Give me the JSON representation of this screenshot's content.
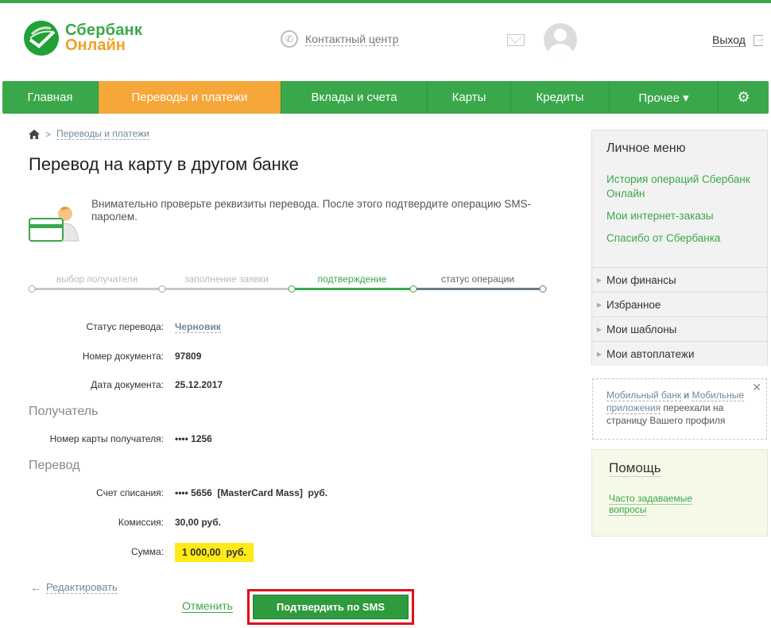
{
  "header": {
    "logo_line1": "Сбербанк",
    "logo_line2": "Онлайн",
    "contact_center": "Контактный центр",
    "logout": "Выход"
  },
  "nav": {
    "items": [
      "Главная",
      "Переводы и платежи",
      "Вклады и счета",
      "Карты",
      "Кредиты",
      "Прочее ▾"
    ],
    "active_index": 1,
    "settings_icon": "gear-icon"
  },
  "breadcrumb": {
    "link": "Переводы и платежи"
  },
  "page_title": "Перевод на карту в другом банке",
  "notice": "Внимательно проверьте реквизиты перевода. После этого подтвердите операцию SMS-паролем.",
  "steps": {
    "labels": [
      "выбор получателя",
      "заполнение заявки",
      "подтверждение",
      "статус операции"
    ],
    "current_index": 2
  },
  "details": {
    "status_label": "Статус перевода:",
    "status_value": "Черновик",
    "doc_number_label": "Номер документа:",
    "doc_number_value": "97809",
    "doc_date_label": "Дата документа:",
    "doc_date_value": "25.12.2017",
    "recipient_section": "Получатель",
    "card_label": "Номер карты получателя:",
    "card_value": "•••• 1256",
    "transfer_section": "Перевод",
    "account_label": "Счет списания:",
    "account_value": "•••• 5656  [MasterCard Mass]  руб.",
    "fee_label": "Комиссия:",
    "fee_value": "30,00 руб.",
    "sum_label": "Сумма:",
    "sum_value": "1 000,00  руб."
  },
  "actions": {
    "edit": "Редактировать",
    "cancel": "Отменить",
    "confirm": "Подтвердить по SMS"
  },
  "personal_menu": {
    "title": "Личное меню",
    "links": [
      "История операций Сбербанк Онлайн",
      "Мои интернет-заказы",
      "Спасибо от Сбербанка"
    ],
    "sections": [
      "Мои финансы",
      "Избранное",
      "Мои шаблоны",
      "Мои автоплатежи"
    ]
  },
  "moved_notice": {
    "link1": "Мобильный банк",
    "and": " и ",
    "link2": "Мобильные приложения",
    "rest": " переехали на страницу Вашего профиля"
  },
  "help": {
    "title": "Помощь",
    "link": "Часто задаваемые вопросы"
  },
  "colors": {
    "brand_green": "#3aa84a",
    "active_orange": "#f5a73a",
    "highlight_yellow": "#ffea17",
    "confirm_border_red": "#e0101a"
  }
}
